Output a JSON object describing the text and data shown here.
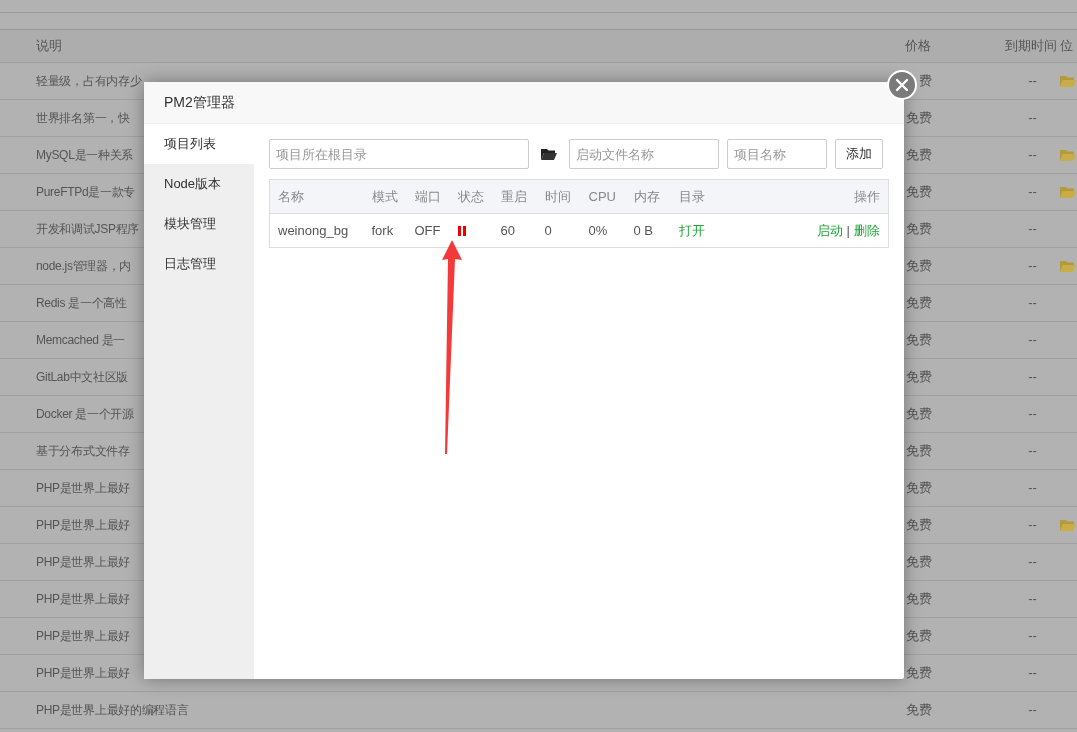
{
  "background_table": {
    "columns": [
      "说明",
      "价格",
      "到期时间",
      "位"
    ],
    "rows": [
      {
        "description": "轻量级，占有内存少",
        "price": "费",
        "expiry": "--",
        "folder": true
      },
      {
        "description": "世界排名第一，快",
        "price": "免费",
        "expiry": "--",
        "folder": false
      },
      {
        "description": "MySQL是一种关系",
        "price": "免费",
        "expiry": "--",
        "folder": true
      },
      {
        "description": "PureFTPd是一款专",
        "price": "免费",
        "expiry": "--",
        "folder": true
      },
      {
        "description": "开发和调试JSP程序",
        "price": "免费",
        "expiry": "--",
        "folder": false
      },
      {
        "description": "node.js管理器，内",
        "price": "免费",
        "expiry": "--",
        "folder": true
      },
      {
        "description": "Redis 是一个高性",
        "price": "免费",
        "expiry": "--",
        "folder": false
      },
      {
        "description": "Memcached 是一",
        "price": "免费",
        "expiry": "--",
        "folder": false
      },
      {
        "description": "GitLab中文社区版",
        "price": "免费",
        "expiry": "--",
        "folder": false
      },
      {
        "description": "Docker 是一个开源",
        "price": "免费",
        "expiry": "--",
        "folder": false
      },
      {
        "description": "基于分布式文件存",
        "price": "免费",
        "expiry": "--",
        "folder": false
      },
      {
        "description": "PHP是世界上最好",
        "price": "免费",
        "expiry": "--",
        "folder": false
      },
      {
        "description": "PHP是世界上最好",
        "price": "免费",
        "expiry": "--",
        "folder": true
      },
      {
        "description": "PHP是世界上最好",
        "price": "免费",
        "expiry": "--",
        "folder": false
      },
      {
        "description": "PHP是世界上最好",
        "price": "免费",
        "expiry": "--",
        "folder": false
      },
      {
        "description": "PHP是世界上最好",
        "price": "免费",
        "expiry": "--",
        "folder": false
      },
      {
        "description": "PHP是世界上最好",
        "price": "免费",
        "expiry": "--",
        "folder": false
      },
      {
        "description": "PHP是世界上最好的编程语言",
        "price": "免费",
        "expiry": "--",
        "folder": false
      }
    ]
  },
  "modal": {
    "title": "PM2管理器",
    "sidebar": [
      {
        "label": "项目列表",
        "selected": true
      },
      {
        "label": "Node版本",
        "selected": false
      },
      {
        "label": "模块管理",
        "selected": false
      },
      {
        "label": "日志管理",
        "selected": false
      }
    ],
    "form": {
      "root_dir_placeholder": "项目所在根目录",
      "start_file_placeholder": "启动文件名称",
      "project_name_placeholder": "项目名称",
      "add_button": "添加"
    },
    "table": {
      "columns": [
        "名称",
        "模式",
        "端口",
        "状态",
        "重启",
        "时间",
        "CPU",
        "内存",
        "目录",
        "操作"
      ],
      "rows": [
        {
          "name": "weinong_bg",
          "mode": "fork",
          "port": "OFF",
          "running": false,
          "restarts": "60",
          "time": "0",
          "cpu": "0%",
          "memory": "0 B",
          "directory": "打开",
          "actions": [
            "启动",
            "删除"
          ],
          "separator": "|"
        }
      ]
    }
  }
}
